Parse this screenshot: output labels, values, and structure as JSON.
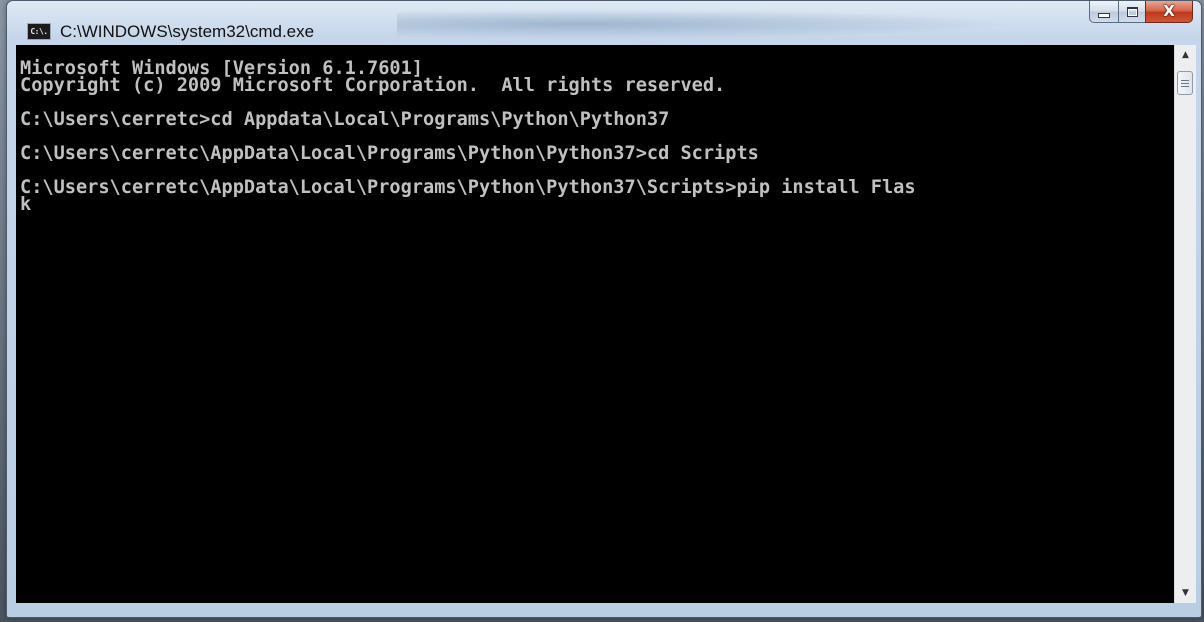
{
  "window": {
    "title": "C:\\WINDOWS\\system32\\cmd.exe",
    "app_icon_text": "C:\\.",
    "icon": "cmd-prompt-icon",
    "close_glyph": "X"
  },
  "console": {
    "lines": [
      "Microsoft Windows [Version 6.1.7601]",
      "Copyright (c) 2009 Microsoft Corporation.  All rights reserved.",
      "",
      "C:\\Users\\cerretc>cd Appdata\\Local\\Programs\\Python\\Python37",
      "",
      "C:\\Users\\cerretc\\AppData\\Local\\Programs\\Python\\Python37>cd Scripts",
      "",
      "C:\\Users\\cerretc\\AppData\\Local\\Programs\\Python\\Python37\\Scripts>pip install Flas",
      "k"
    ],
    "text_color": "#c0c0c0",
    "background_color": "#000000"
  },
  "scrollbar": {
    "up_arrow": "▲",
    "down_arrow": "▼"
  },
  "colors": {
    "close_button": "#c0391b",
    "frame": "#b9cde3"
  }
}
